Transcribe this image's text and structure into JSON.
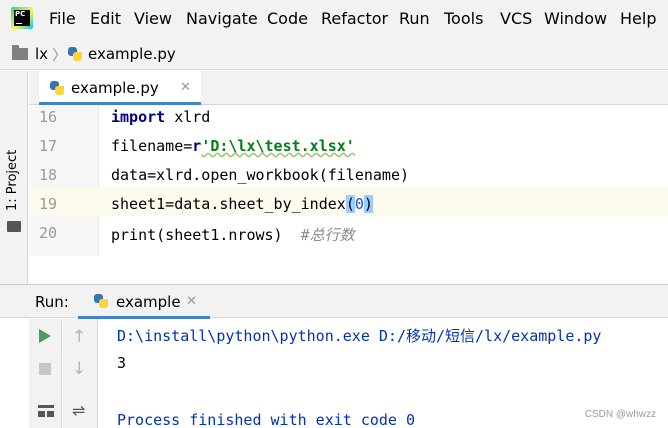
{
  "menubar": {
    "logo_text": "PC",
    "items": [
      "File",
      "Edit",
      "View",
      "Navigate",
      "Code",
      "Refactor",
      "Run",
      "Tools",
      "VCS",
      "Window",
      "Help"
    ]
  },
  "breadcrumb": {
    "project": "lx",
    "file": "example.py"
  },
  "leftstrip": {
    "project_label": "1: Project"
  },
  "editor": {
    "tab_label": "example.py",
    "close_glyph": "✕",
    "lines": [
      {
        "number": "16",
        "code": "import xlrd"
      },
      {
        "number": "17",
        "code": "filename=r'D:\\lx\\test.xlsx'"
      },
      {
        "number": "18",
        "code": "data=xlrd.open_workbook(filename)"
      },
      {
        "number": "19",
        "code": "sheet1=data.sheet_by_index(0)"
      },
      {
        "number": "20",
        "code": "print(sheet1.nrows)  #总行数"
      }
    ]
  },
  "run_panel": {
    "title": "Run:",
    "tab_label": "example",
    "close_glyph": "✕",
    "output": [
      "D:\\install\\python\\python.exe D:/移动/短信/lx/example.py",
      "3",
      "",
      "Process finished with exit code 0"
    ],
    "icons": {
      "rerun": "play-icon",
      "stop": "stop-icon",
      "up": "↑",
      "down": "↓",
      "layout": "layout-icon",
      "soft_wrap": "⇌"
    }
  },
  "watermark": "CSDN @whwzz",
  "colors": {
    "accent": "#4083c9",
    "keyword": "#000080",
    "string": "#067d17",
    "number": "#1750eb",
    "comment": "#8c8c8c",
    "console_text": "#0033b3",
    "current_line": "#fcfaed"
  }
}
